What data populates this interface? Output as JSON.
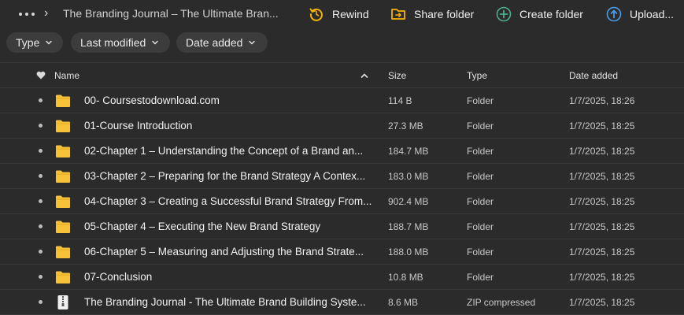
{
  "breadcrumb": {
    "title": "The Branding Journal – The Ultimate Bran..."
  },
  "actions": {
    "rewind": "Rewind",
    "share": "Share folder",
    "create": "Create folder",
    "upload": "Upload..."
  },
  "filters": {
    "type": "Type",
    "last_modified": "Last modified",
    "date_added": "Date added"
  },
  "table": {
    "headers": {
      "name": "Name",
      "size": "Size",
      "type": "Type",
      "date_added": "Date added"
    },
    "rows": [
      {
        "name": "00- Coursestodownload.com",
        "size": "114 B",
        "type": "Folder",
        "date": "1/7/2025, 18:26",
        "icon": "folder-icon"
      },
      {
        "name": "01-Course Introduction",
        "size": "27.3 MB",
        "type": "Folder",
        "date": "1/7/2025, 18:25",
        "icon": "folder-icon"
      },
      {
        "name": "02-Chapter 1 – Understanding the Concept of a Brand an...",
        "size": "184.7 MB",
        "type": "Folder",
        "date": "1/7/2025, 18:25",
        "icon": "folder-icon"
      },
      {
        "name": "03-Chapter 2 – Preparing for the Brand Strategy A Contex...",
        "size": "183.0 MB",
        "type": "Folder",
        "date": "1/7/2025, 18:25",
        "icon": "folder-icon"
      },
      {
        "name": "04-Chapter 3 – Creating a Successful Brand Strategy From...",
        "size": "902.4 MB",
        "type": "Folder",
        "date": "1/7/2025, 18:25",
        "icon": "folder-icon"
      },
      {
        "name": "05-Chapter 4 – Executing the New Brand Strategy",
        "size": "188.7 MB",
        "type": "Folder",
        "date": "1/7/2025, 18:25",
        "icon": "folder-icon"
      },
      {
        "name": "06-Chapter 5 – Measuring and Adjusting the Brand Strate...",
        "size": "188.0 MB",
        "type": "Folder",
        "date": "1/7/2025, 18:25",
        "icon": "folder-icon"
      },
      {
        "name": "07-Conclusion",
        "size": "10.8 MB",
        "type": "Folder",
        "date": "1/7/2025, 18:25",
        "icon": "folder-icon"
      },
      {
        "name": "The Branding Journal - The Ultimate Brand Building Syste...",
        "size": "8.6 MB",
        "type": "ZIP compressed",
        "date": "1/7/2025, 18:25",
        "icon": "zip-icon"
      }
    ]
  },
  "colors": {
    "background": "#2b2b2b",
    "chip": "#3c3c3c",
    "folder": "#f5c238",
    "rewind": "#f5b301",
    "share": "#f5b301",
    "create": "#4caf8d",
    "upload": "#4a9ee8"
  }
}
